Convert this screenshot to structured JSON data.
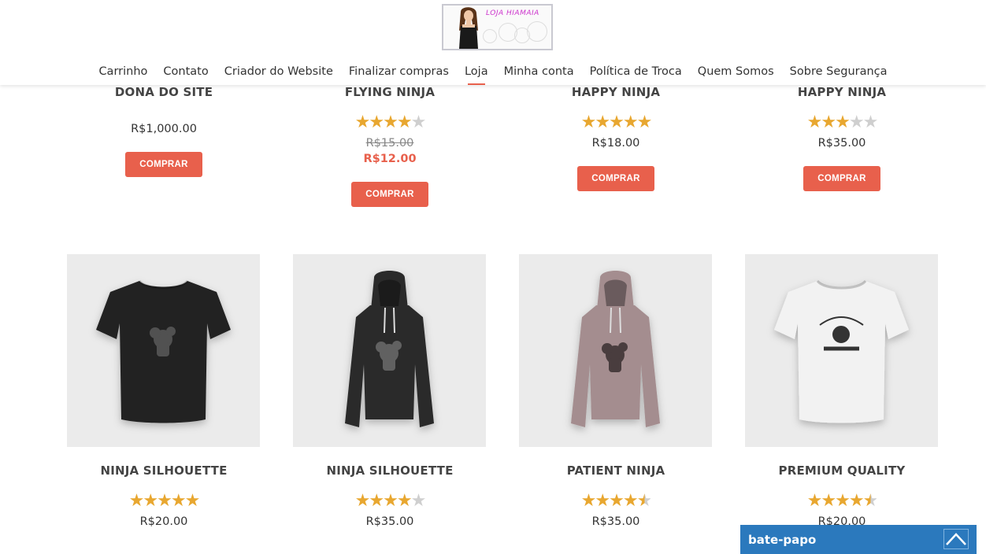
{
  "header": {
    "logo_text": "LOJA HIAMAIA",
    "nav": [
      {
        "label": "Carrinho"
      },
      {
        "label": "Contato"
      },
      {
        "label": "Criador do Website"
      },
      {
        "label": "Finalizar compras"
      },
      {
        "label": "Loja",
        "active": true
      },
      {
        "label": "Minha conta"
      },
      {
        "label": "Política de Troca"
      },
      {
        "label": "Quem Somos"
      },
      {
        "label": "Sobre Segurança"
      }
    ]
  },
  "row1": [
    {
      "title": "DONA DO SITE",
      "rating": 0,
      "price": "R$1,000.00",
      "button": "COMPRAR"
    },
    {
      "title": "FLYING NINJA",
      "rating": 4,
      "price_old": "R$15.00",
      "price_sale": "R$12.00",
      "button": "COMPRAR"
    },
    {
      "title": "HAPPY NINJA",
      "rating": 5,
      "price": "R$18.00",
      "button": "COMPRAR"
    },
    {
      "title": "HAPPY NINJA",
      "rating": 3,
      "price": "R$35.00",
      "button": "COMPRAR"
    }
  ],
  "row2": [
    {
      "title": "NINJA SILHOUETTE",
      "rating": 5,
      "price": "R$20.00",
      "image": "black-tshirt"
    },
    {
      "title": "NINJA SILHOUETTE",
      "rating": 4,
      "price": "R$35.00",
      "image": "black-hoodie"
    },
    {
      "title": "PATIENT NINJA",
      "rating": 4.5,
      "price": "R$35.00",
      "image": "mauve-hoodie"
    },
    {
      "title": "PREMIUM QUALITY",
      "rating": 4.5,
      "price": "R$20.00",
      "image": "white-tshirt"
    }
  ],
  "chat": {
    "label": "bate-papo"
  },
  "colors": {
    "accent": "#e8604c",
    "star": "#e8a730",
    "chat": "#2b79bd"
  }
}
